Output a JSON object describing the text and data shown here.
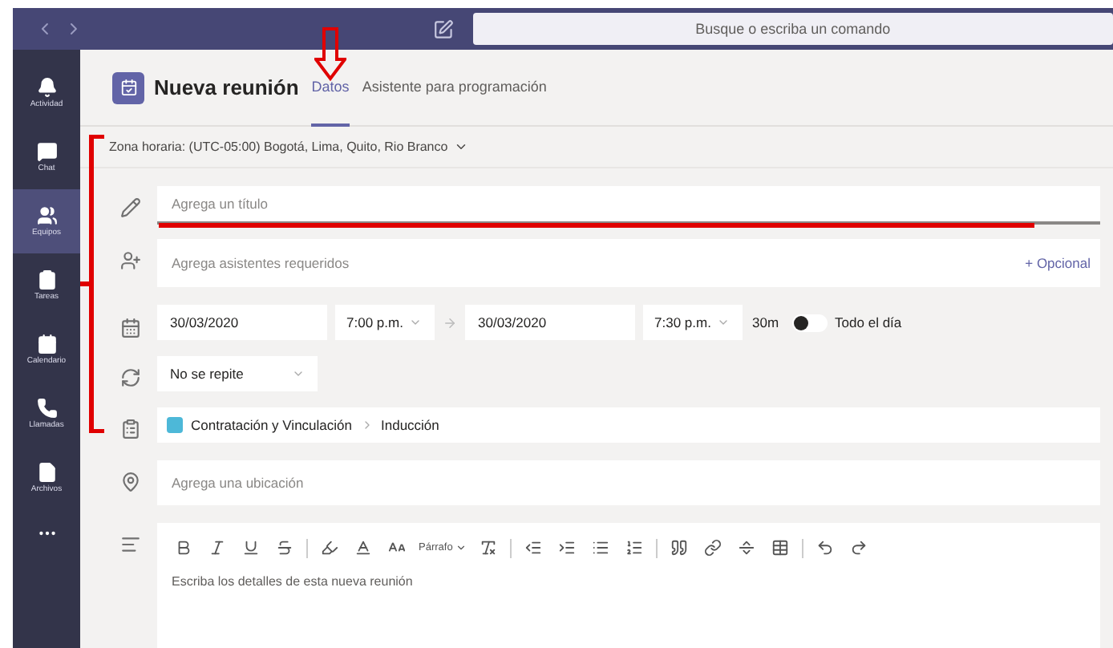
{
  "window": {
    "search": {
      "placeholder": "Busque o escriba un comando"
    }
  },
  "sidebar": {
    "items": [
      {
        "label": "Actividad",
        "selected": false
      },
      {
        "label": "Chat",
        "selected": false
      },
      {
        "label": "Equipos",
        "selected": true
      },
      {
        "label": "Tareas",
        "selected": false
      },
      {
        "label": "Calendario",
        "selected": false
      },
      {
        "label": "Llamadas",
        "selected": false
      },
      {
        "label": "Archivos",
        "selected": false
      }
    ]
  },
  "header": {
    "title": "Nueva reunión",
    "tabs": [
      {
        "label": "Datos",
        "selected": true
      },
      {
        "label": "Asistente para programación",
        "selected": false
      }
    ]
  },
  "timezone": "Zona horaria: (UTC-05:00) Bogotá, Lima, Quito, Rio Branco",
  "title_field": {
    "placeholder": "Agrega un título"
  },
  "attendees": {
    "placeholder": "Agrega asistentes requeridos",
    "optional": "+ Opcional"
  },
  "schedule": {
    "start_date": "30/03/2020",
    "start_time": "7:00 p.m.",
    "end_date": "30/03/2020",
    "end_time": "7:30 p.m.",
    "duration": "30m",
    "all_day": {
      "label": "Todo el día",
      "on": false
    }
  },
  "repeat": "No se repite",
  "channel": {
    "team": "Contratación y Vinculación",
    "channel": "Inducción"
  },
  "location": {
    "placeholder": "Agrega una ubicación"
  },
  "details": {
    "paragraph_style": "Párrafo",
    "placeholder": "Escriba los detalles de esta nueva reunión"
  }
}
